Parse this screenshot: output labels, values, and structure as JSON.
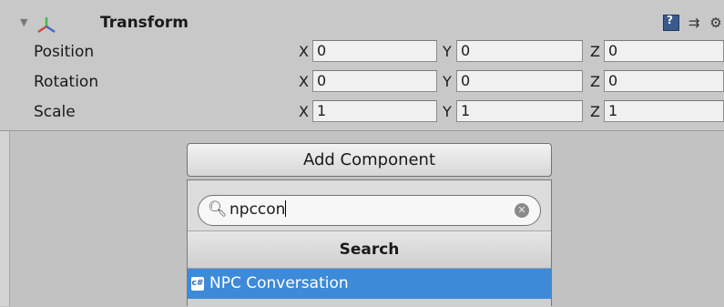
{
  "transform": {
    "title": "Transform",
    "rows": [
      {
        "label": "Position",
        "x": "0",
        "y": "0",
        "z": "0"
      },
      {
        "label": "Rotation",
        "x": "0",
        "y": "0",
        "z": "0"
      },
      {
        "label": "Scale",
        "x": "1",
        "y": "1",
        "z": "1"
      }
    ],
    "axis_labels": {
      "x": "X",
      "y": "Y",
      "z": "Z"
    },
    "header_icons": [
      "help-book-icon",
      "preset-icon",
      "gear-icon"
    ]
  },
  "add_component": {
    "button_label": "Add Component",
    "search_value": "npccon",
    "section_title": "Search",
    "results": [
      {
        "label": "NPC Conversation",
        "icon": "csharp-script-icon",
        "selected": true
      }
    ]
  },
  "colors": {
    "selection": "#3d8ad8",
    "panel_bg": "#c8c8c8",
    "field_bg": "#f0f0f0"
  }
}
